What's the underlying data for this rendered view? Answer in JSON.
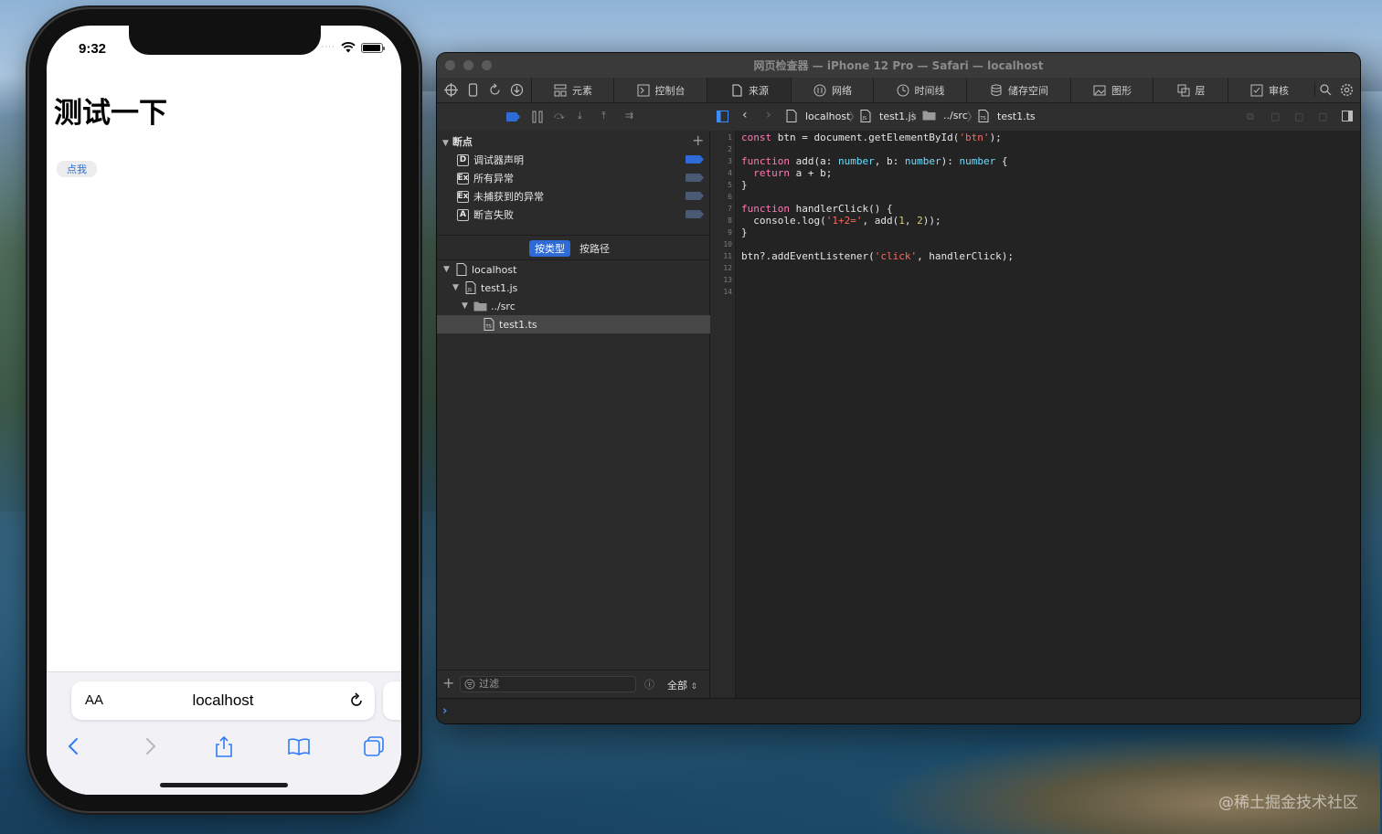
{
  "desktop": {
    "watermark": "@稀土掘金技术社区"
  },
  "phone": {
    "status": {
      "time": "9:32"
    },
    "page": {
      "heading": "测试一下",
      "button_label": "点我"
    },
    "safari": {
      "aa_label": "AA",
      "url": "localhost"
    },
    "icons": [
      "wifi-icon",
      "battery-icon",
      "reload-icon",
      "back-icon",
      "forward-icon",
      "share-icon",
      "bookmarks-icon",
      "tabs-icon"
    ]
  },
  "inspector": {
    "window_title": "网页检查器 — iPhone 12 Pro — Safari — localhost",
    "tabs": [
      {
        "label": "元素",
        "icon": "elements-icon"
      },
      {
        "label": "控制台",
        "icon": "console-icon"
      },
      {
        "label": "来源",
        "icon": "sources-icon"
      },
      {
        "label": "网络",
        "icon": "network-icon"
      },
      {
        "label": "时间线",
        "icon": "timeline-icon"
      },
      {
        "label": "储存空间",
        "icon": "storage-icon"
      },
      {
        "label": "图形",
        "icon": "graphics-icon"
      },
      {
        "label": "层",
        "icon": "layers-icon"
      },
      {
        "label": "审核",
        "icon": "audit-icon"
      }
    ],
    "active_tab": "来源",
    "breadcrumb": [
      "localhost",
      "test1.js",
      "../src",
      "test1.ts"
    ],
    "breakpoints": {
      "header": "断点",
      "items": [
        {
          "badge": "D",
          "label": "调试器声明",
          "active": true
        },
        {
          "badge": "Ex",
          "label": "所有异常",
          "active": false
        },
        {
          "badge": "Ex",
          "label": "未捕获到的异常",
          "active": false
        },
        {
          "badge": "A",
          "label": "断言失败",
          "active": false
        }
      ]
    },
    "group_by": {
      "by_type": "按类型",
      "by_path": "按路径",
      "selected": "按类型"
    },
    "tree": [
      {
        "label": "localhost",
        "depth": 0,
        "kind": "file",
        "expanded": true
      },
      {
        "label": "test1.js",
        "depth": 1,
        "kind": "file",
        "expanded": true
      },
      {
        "label": "../src",
        "depth": 2,
        "kind": "folder",
        "expanded": true
      },
      {
        "label": "test1.ts",
        "depth": 3,
        "kind": "file",
        "selected": true
      }
    ],
    "filter": {
      "placeholder": "过滤",
      "scope": "全部"
    },
    "code": {
      "line_numbers": [
        "1",
        "2",
        "3",
        "4",
        "5",
        "6",
        "7",
        "8",
        "9",
        "10",
        "11",
        "12",
        "13",
        "14"
      ],
      "lines": [
        "const btn = document.getElementById('btn');",
        "",
        "function add(a: number, b: number): number {",
        "  return a + b;",
        "}",
        "",
        "function handlerClick() {",
        "  console.log('1+2=', add(1, 2));",
        "}",
        "",
        "btn?.addEventListener('click', handlerClick);",
        "",
        "",
        ""
      ]
    },
    "colors": {
      "accent": "#2e6bd6",
      "keyword": "#ff7ab2",
      "type": "#6bdfff",
      "string": "#fc6a5d",
      "number": "#d9c97c"
    }
  }
}
